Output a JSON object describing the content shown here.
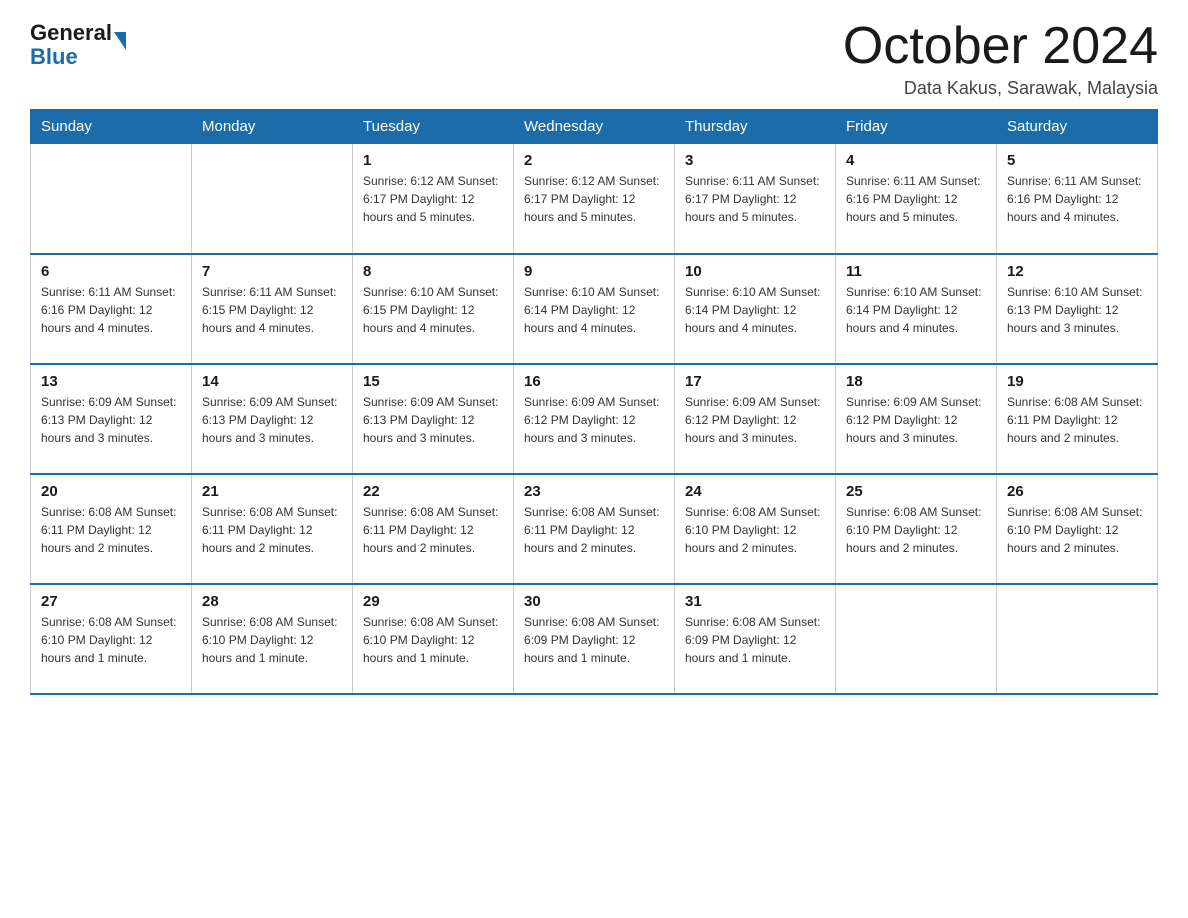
{
  "header": {
    "logo_general": "General",
    "logo_blue": "Blue",
    "month_title": "October 2024",
    "location": "Data Kakus, Sarawak, Malaysia"
  },
  "columns": [
    "Sunday",
    "Monday",
    "Tuesday",
    "Wednesday",
    "Thursday",
    "Friday",
    "Saturday"
  ],
  "weeks": [
    [
      {
        "day": "",
        "info": ""
      },
      {
        "day": "",
        "info": ""
      },
      {
        "day": "1",
        "info": "Sunrise: 6:12 AM\nSunset: 6:17 PM\nDaylight: 12 hours\nand 5 minutes."
      },
      {
        "day": "2",
        "info": "Sunrise: 6:12 AM\nSunset: 6:17 PM\nDaylight: 12 hours\nand 5 minutes."
      },
      {
        "day": "3",
        "info": "Sunrise: 6:11 AM\nSunset: 6:17 PM\nDaylight: 12 hours\nand 5 minutes."
      },
      {
        "day": "4",
        "info": "Sunrise: 6:11 AM\nSunset: 6:16 PM\nDaylight: 12 hours\nand 5 minutes."
      },
      {
        "day": "5",
        "info": "Sunrise: 6:11 AM\nSunset: 6:16 PM\nDaylight: 12 hours\nand 4 minutes."
      }
    ],
    [
      {
        "day": "6",
        "info": "Sunrise: 6:11 AM\nSunset: 6:16 PM\nDaylight: 12 hours\nand 4 minutes."
      },
      {
        "day": "7",
        "info": "Sunrise: 6:11 AM\nSunset: 6:15 PM\nDaylight: 12 hours\nand 4 minutes."
      },
      {
        "day": "8",
        "info": "Sunrise: 6:10 AM\nSunset: 6:15 PM\nDaylight: 12 hours\nand 4 minutes."
      },
      {
        "day": "9",
        "info": "Sunrise: 6:10 AM\nSunset: 6:14 PM\nDaylight: 12 hours\nand 4 minutes."
      },
      {
        "day": "10",
        "info": "Sunrise: 6:10 AM\nSunset: 6:14 PM\nDaylight: 12 hours\nand 4 minutes."
      },
      {
        "day": "11",
        "info": "Sunrise: 6:10 AM\nSunset: 6:14 PM\nDaylight: 12 hours\nand 4 minutes."
      },
      {
        "day": "12",
        "info": "Sunrise: 6:10 AM\nSunset: 6:13 PM\nDaylight: 12 hours\nand 3 minutes."
      }
    ],
    [
      {
        "day": "13",
        "info": "Sunrise: 6:09 AM\nSunset: 6:13 PM\nDaylight: 12 hours\nand 3 minutes."
      },
      {
        "day": "14",
        "info": "Sunrise: 6:09 AM\nSunset: 6:13 PM\nDaylight: 12 hours\nand 3 minutes."
      },
      {
        "day": "15",
        "info": "Sunrise: 6:09 AM\nSunset: 6:13 PM\nDaylight: 12 hours\nand 3 minutes."
      },
      {
        "day": "16",
        "info": "Sunrise: 6:09 AM\nSunset: 6:12 PM\nDaylight: 12 hours\nand 3 minutes."
      },
      {
        "day": "17",
        "info": "Sunrise: 6:09 AM\nSunset: 6:12 PM\nDaylight: 12 hours\nand 3 minutes."
      },
      {
        "day": "18",
        "info": "Sunrise: 6:09 AM\nSunset: 6:12 PM\nDaylight: 12 hours\nand 3 minutes."
      },
      {
        "day": "19",
        "info": "Sunrise: 6:08 AM\nSunset: 6:11 PM\nDaylight: 12 hours\nand 2 minutes."
      }
    ],
    [
      {
        "day": "20",
        "info": "Sunrise: 6:08 AM\nSunset: 6:11 PM\nDaylight: 12 hours\nand 2 minutes."
      },
      {
        "day": "21",
        "info": "Sunrise: 6:08 AM\nSunset: 6:11 PM\nDaylight: 12 hours\nand 2 minutes."
      },
      {
        "day": "22",
        "info": "Sunrise: 6:08 AM\nSunset: 6:11 PM\nDaylight: 12 hours\nand 2 minutes."
      },
      {
        "day": "23",
        "info": "Sunrise: 6:08 AM\nSunset: 6:11 PM\nDaylight: 12 hours\nand 2 minutes."
      },
      {
        "day": "24",
        "info": "Sunrise: 6:08 AM\nSunset: 6:10 PM\nDaylight: 12 hours\nand 2 minutes."
      },
      {
        "day": "25",
        "info": "Sunrise: 6:08 AM\nSunset: 6:10 PM\nDaylight: 12 hours\nand 2 minutes."
      },
      {
        "day": "26",
        "info": "Sunrise: 6:08 AM\nSunset: 6:10 PM\nDaylight: 12 hours\nand 2 minutes."
      }
    ],
    [
      {
        "day": "27",
        "info": "Sunrise: 6:08 AM\nSunset: 6:10 PM\nDaylight: 12 hours\nand 1 minute."
      },
      {
        "day": "28",
        "info": "Sunrise: 6:08 AM\nSunset: 6:10 PM\nDaylight: 12 hours\nand 1 minute."
      },
      {
        "day": "29",
        "info": "Sunrise: 6:08 AM\nSunset: 6:10 PM\nDaylight: 12 hours\nand 1 minute."
      },
      {
        "day": "30",
        "info": "Sunrise: 6:08 AM\nSunset: 6:09 PM\nDaylight: 12 hours\nand 1 minute."
      },
      {
        "day": "31",
        "info": "Sunrise: 6:08 AM\nSunset: 6:09 PM\nDaylight: 12 hours\nand 1 minute."
      },
      {
        "day": "",
        "info": ""
      },
      {
        "day": "",
        "info": ""
      }
    ]
  ]
}
